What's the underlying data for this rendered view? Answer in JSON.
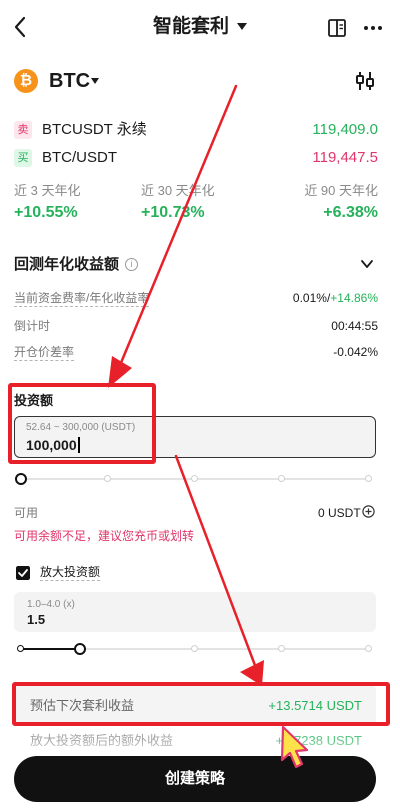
{
  "header": {
    "back_icon": "chevron-left-icon",
    "title": "智能套利",
    "guide_icon": "book-icon",
    "more_icon": "more-dots-icon"
  },
  "coin": {
    "symbol_glyph": "₿",
    "name": "BTC",
    "icon_color": "#f7931a"
  },
  "pairs": [
    {
      "side": "卖",
      "name": "BTCUSDT 永续",
      "price": "119,409.0"
    },
    {
      "side": "买",
      "name": "BTC/USDT",
      "price": "119,447.5"
    }
  ],
  "yields": [
    {
      "label": "近 3 天年化",
      "value": "+10.55%"
    },
    {
      "label": "近 30 天年化",
      "value": "+10.73%"
    },
    {
      "label": "近 90 天年化",
      "value": "+6.38%"
    }
  ],
  "backtest": {
    "title": "回测年化收益额",
    "info_glyph": "i",
    "rows": [
      {
        "label": "当前资金费率/年化收益率",
        "value_a": "0.01%/",
        "value_b": "+14.86%"
      },
      {
        "label": "倒计时",
        "value": "00:44:55"
      },
      {
        "label": "开仓价差率",
        "value": "-0.042%"
      }
    ]
  },
  "investment": {
    "title": "投资额",
    "placeholder": "52.64 ~ 300,000 (USDT)",
    "value": "100,000",
    "slider_fraction": 0
  },
  "available": {
    "label": "可用",
    "value": "0 USDT",
    "warning": "可用余额不足，建议您充币或划转"
  },
  "leverage": {
    "label": "放大投资额",
    "checked": true,
    "placeholder": "1.0–4.0 (x)",
    "value": "1.5",
    "slider_fraction": 0.17
  },
  "estimate": {
    "label": "预估下次套利收益",
    "value": "+13.5714 USDT",
    "extra_label": "放大投资额后的额外收益",
    "extra_value": "+6.7238 USDT"
  },
  "create_button": "创建策略",
  "colors": {
    "green": "#25b25a",
    "red": "#e0366b",
    "annotation": "#e8202a",
    "cursor": "#ffe14a"
  }
}
